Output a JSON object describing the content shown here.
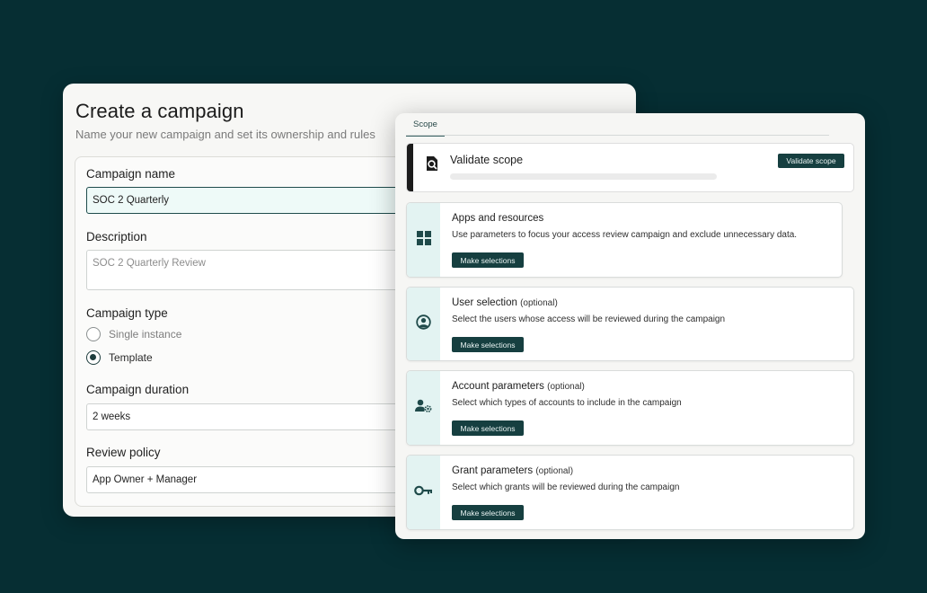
{
  "campaign": {
    "title": "Create a campaign",
    "subtitle": "Name your new campaign and set its ownership and rules",
    "name_label": "Campaign name",
    "name_value": "SOC 2 Quarterly",
    "description_label": "Description",
    "description_placeholder": "SOC 2 Quarterly Review",
    "type_label": "Campaign type",
    "type_options": [
      {
        "label": "Single instance",
        "selected": false
      },
      {
        "label": "Template",
        "selected": true
      }
    ],
    "duration_label": "Campaign duration",
    "duration_value": "2 weeks",
    "policy_label": "Review policy",
    "policy_value": "App Owner + Manager"
  },
  "scope": {
    "tab_label": "Scope",
    "validate": {
      "title": "Validate scope",
      "button_label": "Validate scope",
      "icon": "search-document-icon"
    },
    "items": [
      {
        "title": "Apps and resources",
        "optional": "",
        "description": "Use parameters to focus your access review campaign and exclude unnecessary data.",
        "button_label": "Make selections",
        "icon": "grid-icon"
      },
      {
        "title": "User selection",
        "optional": "(optional)",
        "description": "Select the users whose access will be reviewed during the campaign",
        "button_label": "Make selections",
        "icon": "user-circle-icon"
      },
      {
        "title": "Account parameters",
        "optional": "(optional)",
        "description": "Select which types of accounts to include in the campaign",
        "button_label": "Make selections",
        "icon": "user-gear-icon"
      },
      {
        "title": "Grant parameters",
        "optional": "(optional)",
        "description": "Select which grants will be reviewed during the campaign",
        "button_label": "Make selections",
        "icon": "key-icon"
      }
    ]
  },
  "colors": {
    "background": "#062e33",
    "accent": "#163f40",
    "icon_tint": "#e3f3f2",
    "active_field_bg": "#eefaf8"
  }
}
